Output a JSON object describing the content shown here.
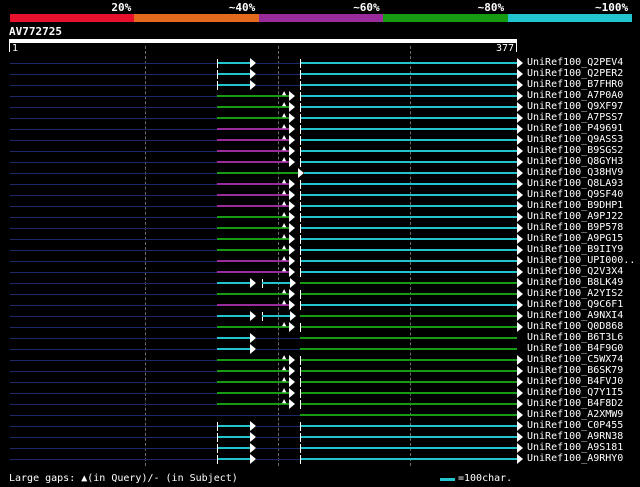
{
  "legend": [
    {
      "label": "20%",
      "color": "#e8112d"
    },
    {
      "label": "~40%",
      "color": "#e46a1e"
    },
    {
      "label": "~60%",
      "color": "#9a2b9a"
    },
    {
      "label": "~80%",
      "color": "#179b13"
    },
    {
      "label": "~100%",
      "color": "#22c4cf"
    }
  ],
  "query": {
    "id": "AV772725",
    "start": "1",
    "end": "377"
  },
  "hits": [
    {
      "name": "UniRef100_Q2PEV4",
      "pattern": "A"
    },
    {
      "name": "UniRef100_Q2PER2",
      "pattern": "A"
    },
    {
      "name": "UniRef100_B7FHR0",
      "pattern": "A"
    },
    {
      "name": "UniRef100_A7P0A0",
      "pattern": "G"
    },
    {
      "name": "UniRef100_Q9XF97",
      "pattern": "G"
    },
    {
      "name": "UniRef100_A7PSS7",
      "pattern": "G"
    },
    {
      "name": "UniRef100_P49691",
      "pattern": "P"
    },
    {
      "name": "UniRef100_Q9ASS3",
      "pattern": "P"
    },
    {
      "name": "UniRef100_B9SGS2",
      "pattern": "P"
    },
    {
      "name": "UniRef100_Q8GYH3",
      "pattern": "P"
    },
    {
      "name": "UniRef100_Q38HV9",
      "pattern": "G2"
    },
    {
      "name": "UniRef100_Q8LA93",
      "pattern": "P"
    },
    {
      "name": "UniRef100_Q9SF40",
      "pattern": "P"
    },
    {
      "name": "UniRef100_B9DHP1",
      "pattern": "P"
    },
    {
      "name": "UniRef100_A9PJ22",
      "pattern": "G"
    },
    {
      "name": "UniRef100_B9P578",
      "pattern": "G"
    },
    {
      "name": "UniRef100_A9PG15",
      "pattern": "G"
    },
    {
      "name": "UniRef100_B9IIY9",
      "pattern": "G"
    },
    {
      "name": "UniRef100_UPI000..",
      "pattern": "P"
    },
    {
      "name": "UniRef100_Q2V3X4",
      "pattern": "P"
    },
    {
      "name": "UniRef100_B8LK49",
      "pattern": "CG"
    },
    {
      "name": "UniRef100_A2YIS2",
      "pattern": "G"
    },
    {
      "name": "UniRef100_Q9C6F1",
      "pattern": "P"
    },
    {
      "name": "UniRef100_A9NXI4",
      "pattern": "CG"
    },
    {
      "name": "UniRef100_Q0D868",
      "pattern": "G"
    },
    {
      "name": "UniRef100_B6T3L6",
      "pattern": "C1"
    },
    {
      "name": "UniRef100_B4F9G0",
      "pattern": "C1"
    },
    {
      "name": "UniRef100_C5WX74",
      "pattern": "G"
    },
    {
      "name": "UniRef100_B6SK79",
      "pattern": "G"
    },
    {
      "name": "UniRef100_B4FVJ0",
      "pattern": "G"
    },
    {
      "name": "UniRef100_Q7Y1I5",
      "pattern": "G"
    },
    {
      "name": "UniRef100_B4F8D2",
      "pattern": "G"
    },
    {
      "name": "UniRef100_A2XMW9",
      "pattern": "N"
    },
    {
      "name": "UniRef100_C0P455",
      "pattern": "A"
    },
    {
      "name": "UniRef100_A9RN38",
      "pattern": "A"
    },
    {
      "name": "UniRef100_A9S181",
      "pattern": "A"
    },
    {
      "name": "UniRef100_A9RHY0",
      "pattern": "A"
    }
  ],
  "footer": {
    "gaps_text": "Large gaps: ▲(in Query)/- (in Subject)",
    "scale_text": "=100char."
  }
}
